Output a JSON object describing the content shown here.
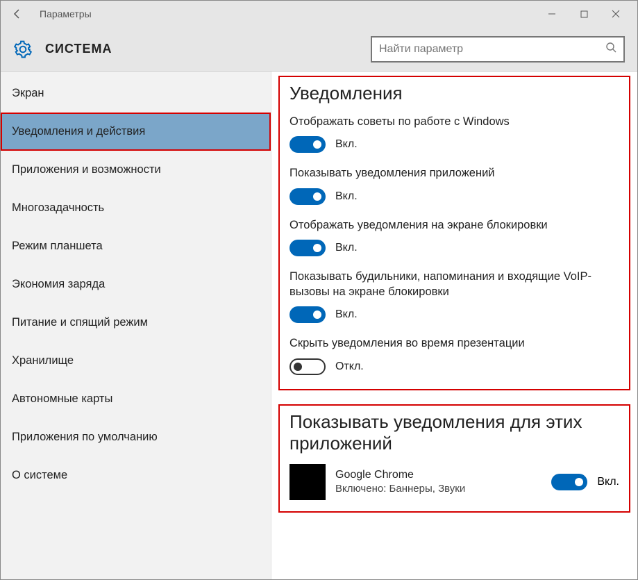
{
  "window": {
    "title": "Параметры"
  },
  "header": {
    "heading": "СИСТЕМА"
  },
  "search": {
    "placeholder": "Найти параметр"
  },
  "sidebar": {
    "items": [
      {
        "label": "Экран"
      },
      {
        "label": "Уведомления и действия"
      },
      {
        "label": "Приложения и возможности"
      },
      {
        "label": "Многозадачность"
      },
      {
        "label": "Режим планшета"
      },
      {
        "label": "Экономия заряда"
      },
      {
        "label": "Питание и спящий режим"
      },
      {
        "label": "Хранилище"
      },
      {
        "label": "Автономные карты"
      },
      {
        "label": "Приложения по умолчанию"
      },
      {
        "label": "О системе"
      }
    ]
  },
  "notifications": {
    "title": "Уведомления",
    "settings": [
      {
        "label": "Отображать советы по работе с Windows",
        "state": "Вкл.",
        "on": true
      },
      {
        "label": "Показывать уведомления приложений",
        "state": "Вкл.",
        "on": true
      },
      {
        "label": "Отображать уведомления на экране блокировки",
        "state": "Вкл.",
        "on": true
      },
      {
        "label": "Показывать будильники, напоминания и входящие VoIP-вызовы на экране блокировки",
        "state": "Вкл.",
        "on": true
      },
      {
        "label": "Скрыть уведомления во время презентации",
        "state": "Откл.",
        "on": false
      }
    ]
  },
  "apps": {
    "title": "Показывать уведомления для этих приложений",
    "items": [
      {
        "name": "Google Chrome",
        "sub": "Включено: Баннеры, Звуки",
        "state": "Вкл.",
        "on": true
      }
    ]
  }
}
